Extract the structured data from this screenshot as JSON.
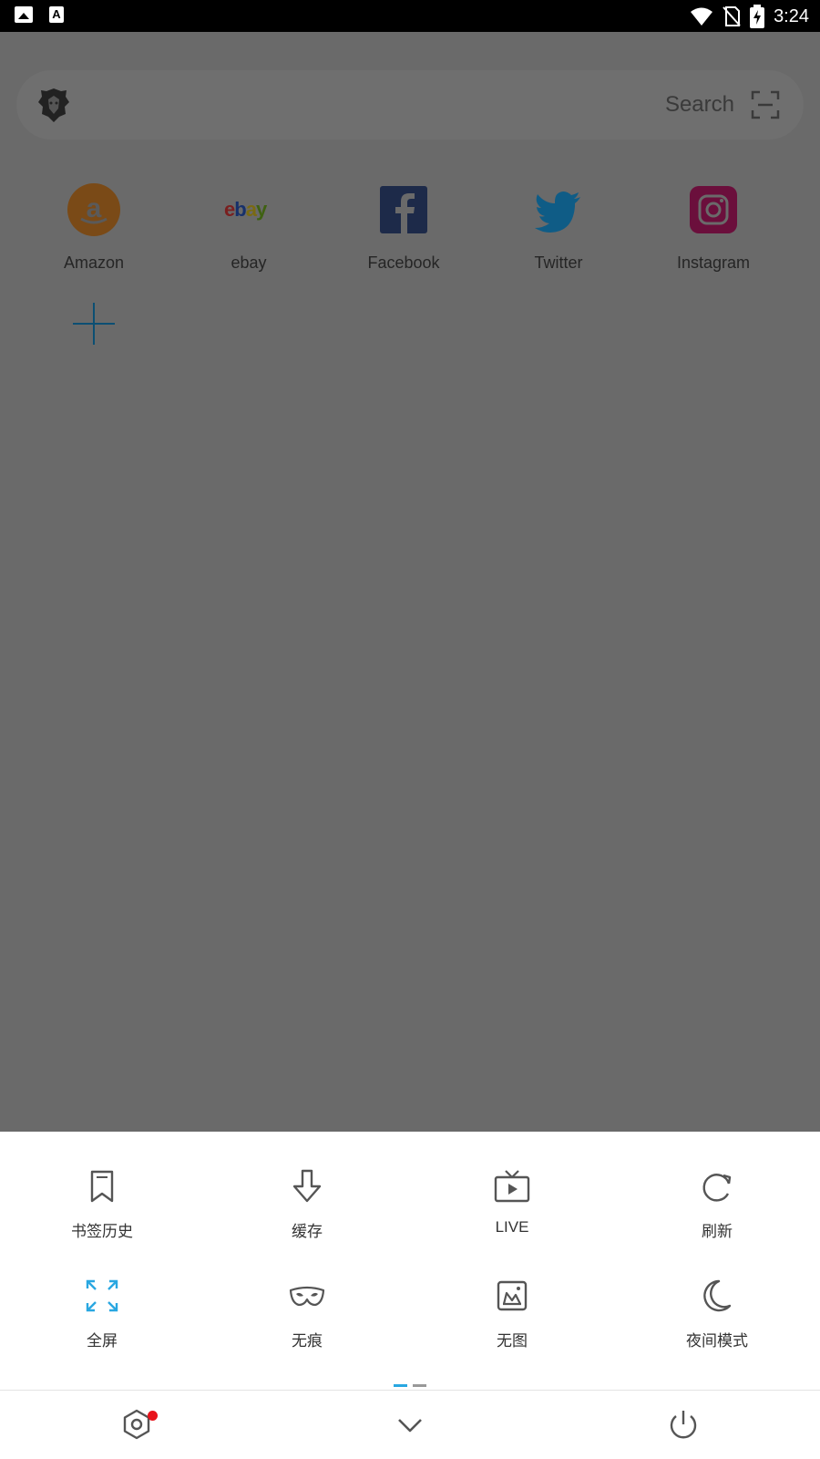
{
  "status_bar": {
    "time": "3:24"
  },
  "search": {
    "placeholder": "Search"
  },
  "speed_dial": [
    {
      "label": "Amazon",
      "icon": "amazon-icon",
      "color": "#7a4a17"
    },
    {
      "label": "ebay",
      "icon": "ebay-icon",
      "color": "#6a6a6a"
    },
    {
      "label": "Facebook",
      "icon": "facebook-icon",
      "color": "#1d2a49"
    },
    {
      "label": "Twitter",
      "icon": "twitter-icon",
      "color": "#0f5c86"
    },
    {
      "label": "Instagram",
      "icon": "instagram-icon",
      "color": "#6b0f3c"
    }
  ],
  "menu": {
    "items": [
      {
        "label": "书签历史",
        "icon": "bookmark-icon"
      },
      {
        "label": "缓存",
        "icon": "download-icon"
      },
      {
        "label": "LIVE",
        "icon": "tv-live-icon"
      },
      {
        "label": "刷新",
        "icon": "refresh-icon"
      },
      {
        "label": "全屏",
        "icon": "fullscreen-icon"
      },
      {
        "label": "无痕",
        "icon": "incognito-mask-icon"
      },
      {
        "label": "无图",
        "icon": "no-image-icon"
      },
      {
        "label": "夜间模式",
        "icon": "moon-icon"
      }
    ],
    "accent": "#29a7e1"
  }
}
